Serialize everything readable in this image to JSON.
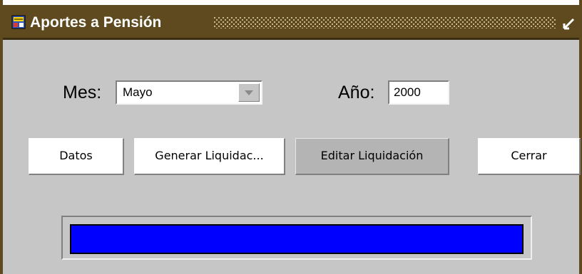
{
  "window": {
    "title": "Aportes a Pensión"
  },
  "form": {
    "month_label": "Mes:",
    "month_value": "Mayo",
    "year_label": "Año:",
    "year_value": "2000"
  },
  "buttons": {
    "datos": "Datos",
    "generar": "Generar Liquidac...",
    "editar": "Editar Liquidación",
    "cerrar": "Cerrar"
  },
  "progress": {
    "fraction": 1.0,
    "color": "#0000ff"
  },
  "colors": {
    "titlebar": "#5e4a1e",
    "window_bg": "#c6c6c6",
    "button_bg": "#ffffff",
    "button_active_bg": "#b4b4b4"
  },
  "icons": {
    "app": "app-form-icon",
    "minimize": "minimize-icon",
    "dropdown": "chevron-down-icon"
  }
}
